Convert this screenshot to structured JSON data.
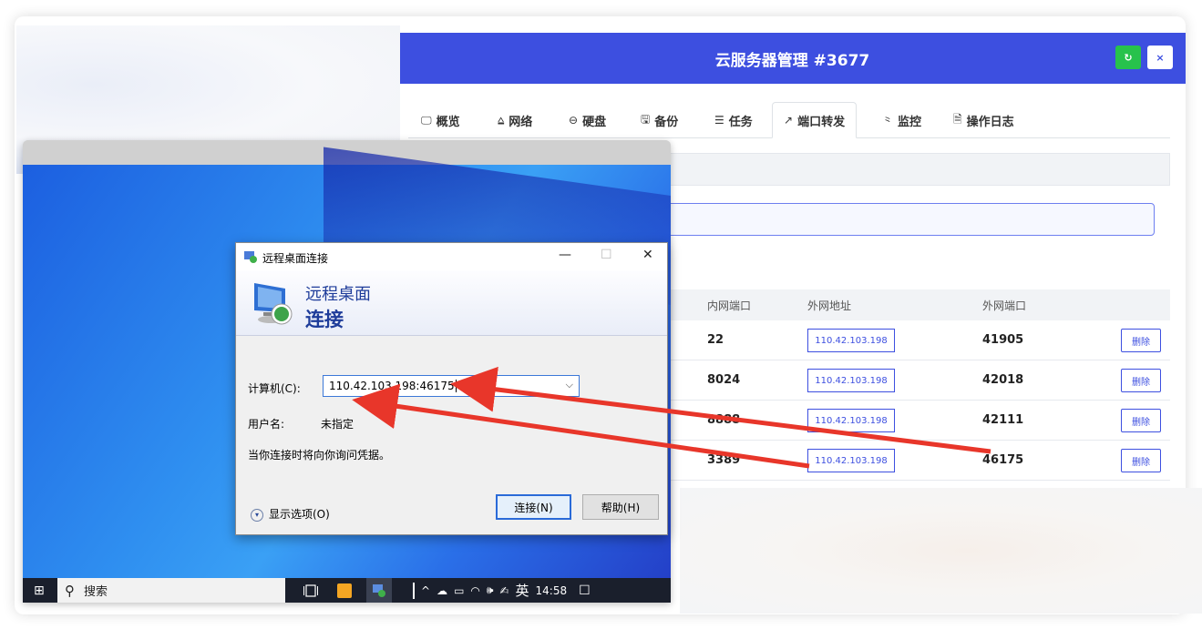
{
  "panel": {
    "title": "云服务器管理 #3677",
    "refresh_icon": "↻",
    "close_icon": "×",
    "accent": "#3d4fe0",
    "refresh_color": "#27c24c"
  },
  "tabs": [
    {
      "icon": "🖵",
      "label": "概览"
    },
    {
      "icon": "⩠",
      "label": "网络"
    },
    {
      "icon": "⊖",
      "label": "硬盘"
    },
    {
      "icon": "🖫",
      "label": "备份"
    },
    {
      "icon": "☰",
      "label": "任务"
    },
    {
      "icon": "↗",
      "label": "端口转发"
    },
    {
      "icon": "⺀",
      "label": "监控"
    },
    {
      "icon": "🗎",
      "label": "操作日志"
    }
  ],
  "table": {
    "headers": [
      "内网端口",
      "外网地址",
      "外网端口"
    ],
    "rows": [
      {
        "internal_port": "22",
        "external_ip": "110.42.103.198",
        "external_port": "41905",
        "action": "删除"
      },
      {
        "internal_port": "8024",
        "external_ip": "110.42.103.198",
        "external_port": "42018",
        "action": "删除"
      },
      {
        "internal_port": "8888",
        "external_ip": "110.42.103.198",
        "external_port": "42111",
        "action": "删除"
      },
      {
        "internal_port": "3389",
        "external_ip": "110.42.103.198",
        "external_port": "46175",
        "action": "删除"
      }
    ]
  },
  "rdp_dialog": {
    "title": "远程桌面连接",
    "minimize": "—",
    "maximize": "☐",
    "close": "✕",
    "banner_line1": "远程桌面",
    "banner_line2": "连接",
    "computer_label": "计算机(C):",
    "computer_value": "110.42.103.198:46175",
    "username_label": "用户名:",
    "username_value": "未指定",
    "credential_note": "当你连接时将向你询问凭据。",
    "show_options": "显示选项(O)",
    "connect_button": "连接(N)",
    "help_button": "帮助(H)"
  },
  "taskbar": {
    "start_icon": "⊞",
    "search_icon": "⚲",
    "search_label": "搜索",
    "ime": "英",
    "time": "14:58",
    "tray_icons": [
      "^",
      "☁",
      "▭",
      "◠",
      "🕪",
      "✍"
    ],
    "notify_icon": "☐"
  }
}
